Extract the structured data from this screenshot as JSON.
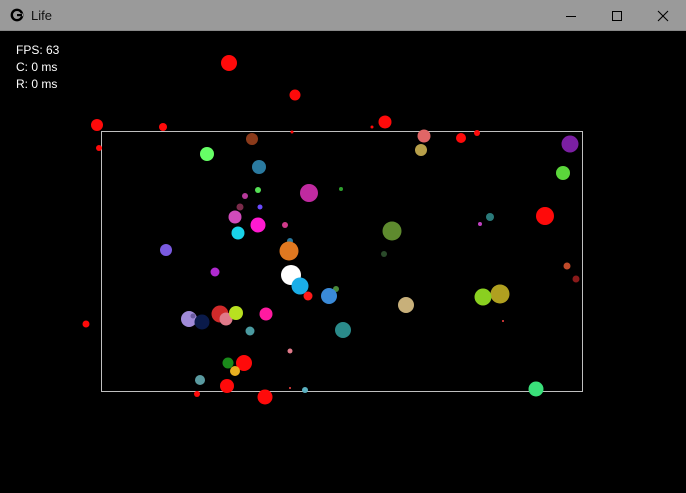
{
  "window": {
    "title": "Life",
    "buttons": {
      "minimize_icon": "minimize-icon",
      "maximize_icon": "maximize-icon",
      "close_icon": "close-icon"
    }
  },
  "stats": {
    "fps": "FPS: 63",
    "compute": "C: 0 ms",
    "render": "R: 0 ms"
  },
  "colors": {
    "titlebar": "#9a9a9a",
    "background": "#000000",
    "bounds": "#bfbfbf"
  }
}
